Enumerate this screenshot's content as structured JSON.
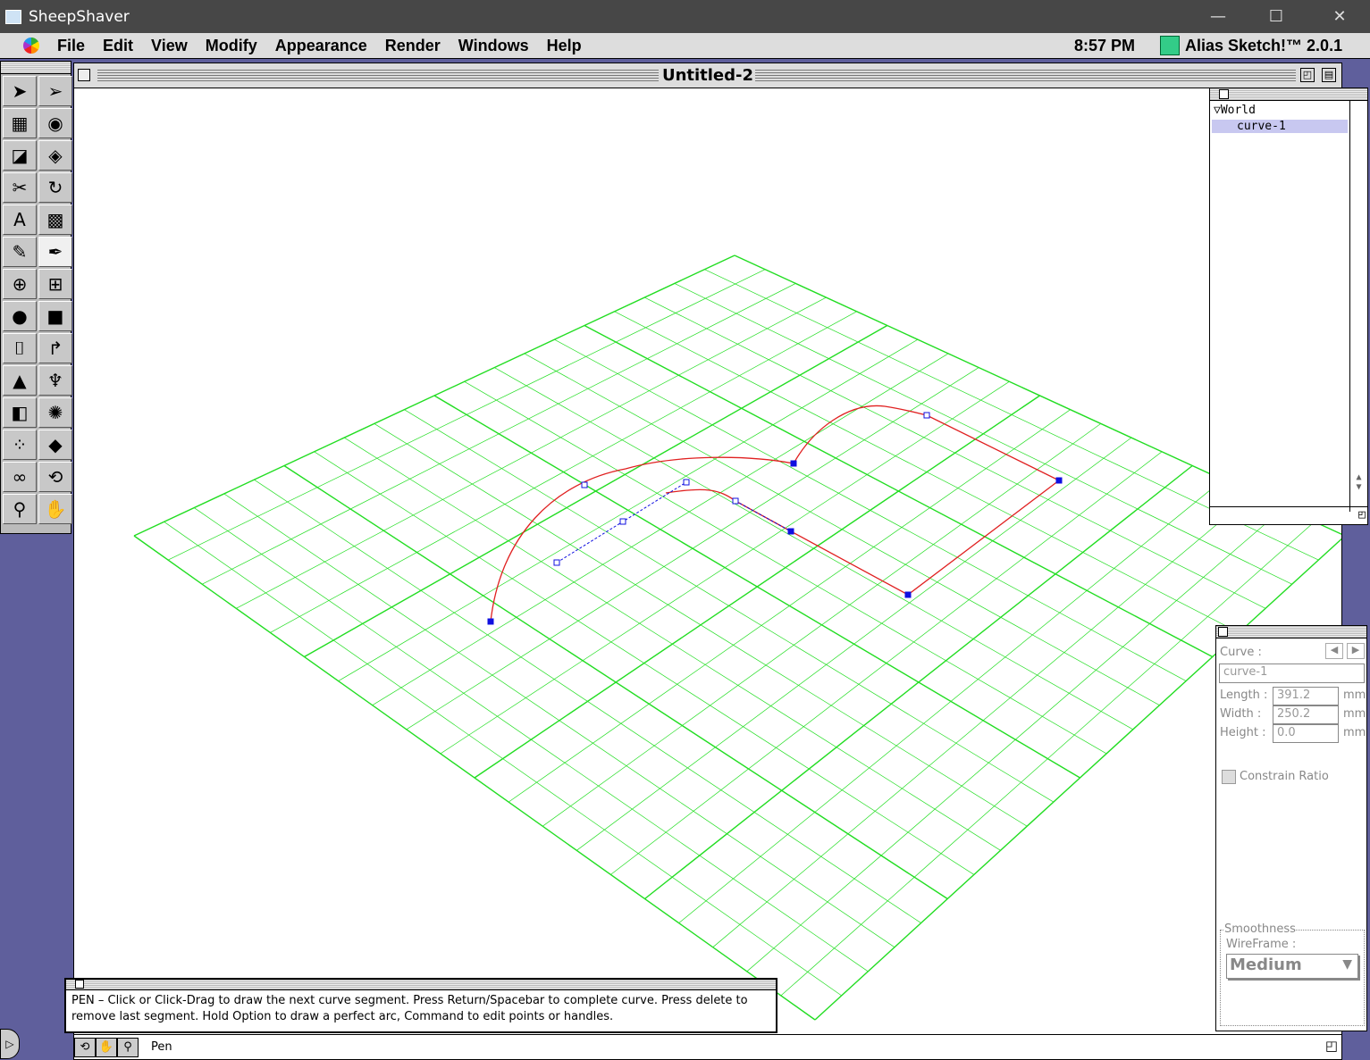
{
  "window": {
    "title": "SheepShaver"
  },
  "menubar": {
    "items": [
      "File",
      "Edit",
      "View",
      "Modify",
      "Appearance",
      "Render",
      "Windows",
      "Help"
    ],
    "clock": "8:57 PM",
    "app_name": "Alias Sketch!™ 2.0.1"
  },
  "document": {
    "title": "Untitled-2"
  },
  "tools": [
    {
      "name": "arrow-select-icon",
      "glyph": "➤"
    },
    {
      "name": "direct-select-icon",
      "glyph": "➢"
    },
    {
      "name": "grid-move-icon",
      "glyph": "▦"
    },
    {
      "name": "target-icon",
      "glyph": "◉"
    },
    {
      "name": "view-plane-icon",
      "glyph": "◪"
    },
    {
      "name": "scale-icon",
      "glyph": "◈"
    },
    {
      "name": "scissors-icon",
      "glyph": "✂"
    },
    {
      "name": "rotate-icon",
      "glyph": "↻"
    },
    {
      "name": "text-icon",
      "glyph": "A"
    },
    {
      "name": "ground-plane-icon",
      "glyph": "▩"
    },
    {
      "name": "pencil-icon",
      "glyph": "✎"
    },
    {
      "name": "pen-icon",
      "glyph": "✒"
    },
    {
      "name": "circle-icon",
      "glyph": "⊕"
    },
    {
      "name": "rectangle-icon",
      "glyph": "⊞"
    },
    {
      "name": "sphere-icon",
      "glyph": "●"
    },
    {
      "name": "cube-icon",
      "glyph": "■"
    },
    {
      "name": "extrude-icon",
      "glyph": "⌷"
    },
    {
      "name": "sweep-icon",
      "glyph": "↱"
    },
    {
      "name": "loft-icon",
      "glyph": "▲"
    },
    {
      "name": "lathe-icon",
      "glyph": "♆"
    },
    {
      "name": "spotlight-icon",
      "glyph": "◧"
    },
    {
      "name": "point-light-icon",
      "glyph": "✺"
    },
    {
      "name": "distant-light-icon",
      "glyph": "⁘"
    },
    {
      "name": "camera-target-icon",
      "glyph": "◆"
    },
    {
      "name": "glasses-icon",
      "glyph": "∞"
    },
    {
      "name": "orbit-icon",
      "glyph": "⟲"
    },
    {
      "name": "zoom-icon",
      "glyph": "⚲"
    },
    {
      "name": "hand-icon",
      "glyph": "✋"
    }
  ],
  "selected_tool": "pen-icon",
  "outliner": {
    "root": "World",
    "items": [
      "curve-1"
    ]
  },
  "properties": {
    "label": "Curve :",
    "name": "curve-1",
    "length_label": "Length :",
    "length": "391.2",
    "width_label": "Width :",
    "width": "250.2",
    "height_label": "Height :",
    "height": "0.0",
    "unit": "mm",
    "constrain_label": "Constrain Ratio",
    "constrain": false,
    "smoothness_label": "Smoothness",
    "wireframe_label": "WireFrame :",
    "wireframe": "Medium"
  },
  "hint": {
    "text": "PEN – Click or Click-Drag to draw the next curve segment. Press Return/Spacebar to complete curve. Press delete to remove last segment. Hold Option to draw a perfect arc, Command to edit points or handles."
  },
  "status": {
    "tool": "Pen"
  },
  "colors": {
    "grid": "#22dd22",
    "curve": "#e02020",
    "handles": "#1010e0",
    "desktop": "#5f5f9c",
    "selection": "#c8c8f0"
  }
}
